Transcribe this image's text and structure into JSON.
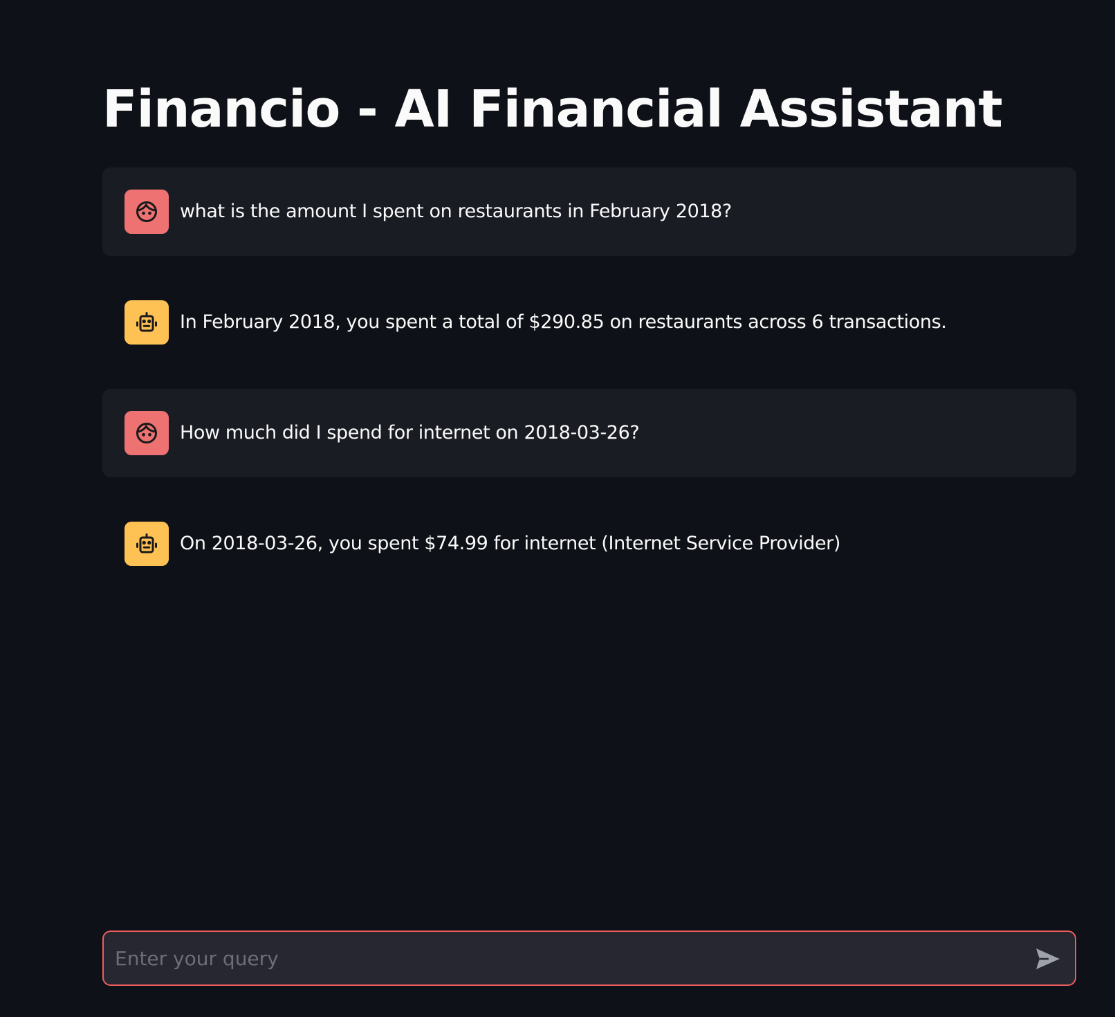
{
  "app": {
    "title": "Financio - AI Financial Assistant"
  },
  "colors": {
    "background": "#0e1117",
    "user_bubble": "#1a1c24",
    "user_avatar": "#ef7273",
    "bot_avatar": "#fdc154",
    "input_border": "#ef5e5e",
    "input_background": "#262730"
  },
  "messages": [
    {
      "role": "user",
      "avatar_icon": "user-face-icon",
      "text": "what is the amount I spent on restaurants in February 2018?"
    },
    {
      "role": "assistant",
      "avatar_icon": "robot-icon",
      "text": "In February 2018, you spent a total of $290.85 on restaurants across 6 transactions."
    },
    {
      "role": "user",
      "avatar_icon": "user-face-icon",
      "text": "How much did I spend for internet on 2018-03-26?"
    },
    {
      "role": "assistant",
      "avatar_icon": "robot-icon",
      "text": "On 2018-03-26, you spent $74.99 for internet (Internet Service Provider)"
    }
  ],
  "chat_input": {
    "value": "",
    "placeholder": "Enter your query",
    "send_icon": "send-icon"
  }
}
